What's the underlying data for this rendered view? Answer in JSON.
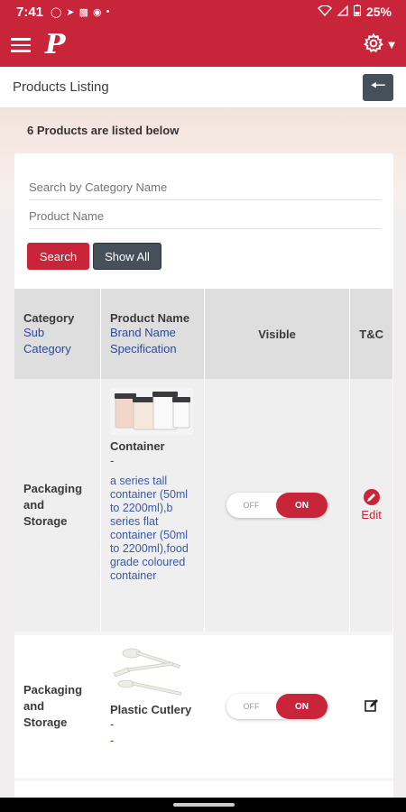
{
  "status": {
    "time": "7:41",
    "battery": "25%"
  },
  "header": {
    "logo": "P"
  },
  "page": {
    "title": "Products Listing"
  },
  "listing": {
    "count_text": "6 Products are listed below"
  },
  "filters": {
    "category_placeholder": "Search by Category Name",
    "product_label": "Product Name",
    "search_label": "Search",
    "show_all_label": "Show All"
  },
  "table": {
    "headers": {
      "category": "Category",
      "sub_category": "Sub Category",
      "product_name": "Product Name",
      "brand_name": "Brand Name",
      "specification": "Specification",
      "visible": "Visible",
      "tc": "T&C"
    },
    "rows": [
      {
        "category": "Packaging and Storage",
        "product": "Container",
        "dash": "-",
        "spec": "a series tall container (50ml to 2200ml),b series flat container (50ml to 2200ml),food grade coloured container",
        "toggle_off": "OFF",
        "toggle_on": "ON",
        "edit_label": "Edit"
      },
      {
        "category": "Packaging and Storage",
        "product": "Plastic Cutlery",
        "dash": "-",
        "dash2": "-",
        "toggle_off": "OFF",
        "toggle_on": "ON"
      }
    ]
  }
}
